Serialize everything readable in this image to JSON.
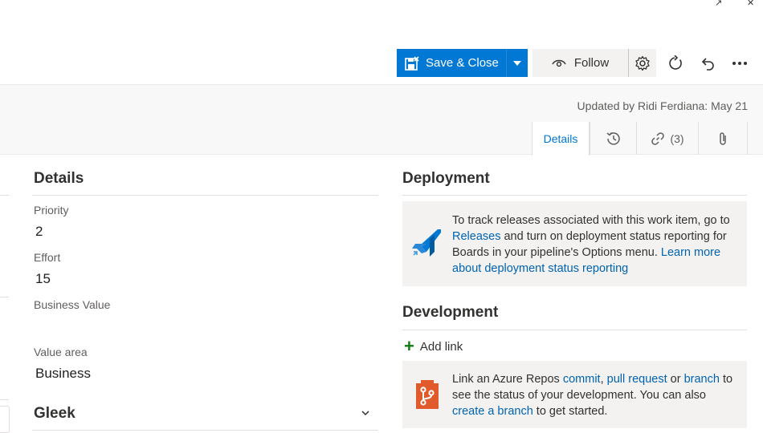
{
  "window": {
    "controls": [
      "↗",
      "✕"
    ]
  },
  "toolbar": {
    "save_close_label": "Save & Close",
    "follow_label": "Follow",
    "icons": [
      "save-icon",
      "caret-down-icon",
      "eye-icon",
      "gear-icon",
      "refresh-icon",
      "undo-icon",
      "more-icon"
    ]
  },
  "header": {
    "updated_text": "Updated by Ridi Ferdiana: May 21",
    "tabs": [
      {
        "label": "Details",
        "active": true
      },
      {
        "label": "",
        "icon": "history-icon"
      },
      {
        "label": "(3)",
        "icon": "link-icon"
      },
      {
        "label": "",
        "icon": "attachment-icon"
      }
    ]
  },
  "details": {
    "title": "Details",
    "fields": [
      {
        "label": "Priority",
        "value": "2"
      },
      {
        "label": "Effort",
        "value": "15"
      },
      {
        "label": "Business Value",
        "value": ""
      },
      {
        "label": "Value area",
        "value": "Business"
      }
    ]
  },
  "gleek": {
    "title": "Gleek"
  },
  "deployment": {
    "title": "Deployment",
    "text_1": "To track releases associated with this work item, go to",
    "link_releases": "Releases",
    "text_2": "and turn on deployment status reporting for Boards in your pipeline's Options menu.",
    "link_learn": "Learn more about deployment status reporting"
  },
  "development": {
    "title": "Development",
    "add_link_label": "Add link",
    "text_1": "Link an Azure Repos",
    "link_commit": "commit",
    "link_pull_request": "pull request",
    "text_or": "or",
    "link_branch": "branch",
    "text_2": "to see the status of your development. You can also",
    "link_create_branch": "create a branch",
    "text_3": "to get started."
  },
  "colors": {
    "accent": "#0078d4",
    "link": "#0063b1",
    "panel_bg": "#f3f2f1",
    "add_green": "#107c10",
    "repos_orange": "#e05a2b"
  }
}
